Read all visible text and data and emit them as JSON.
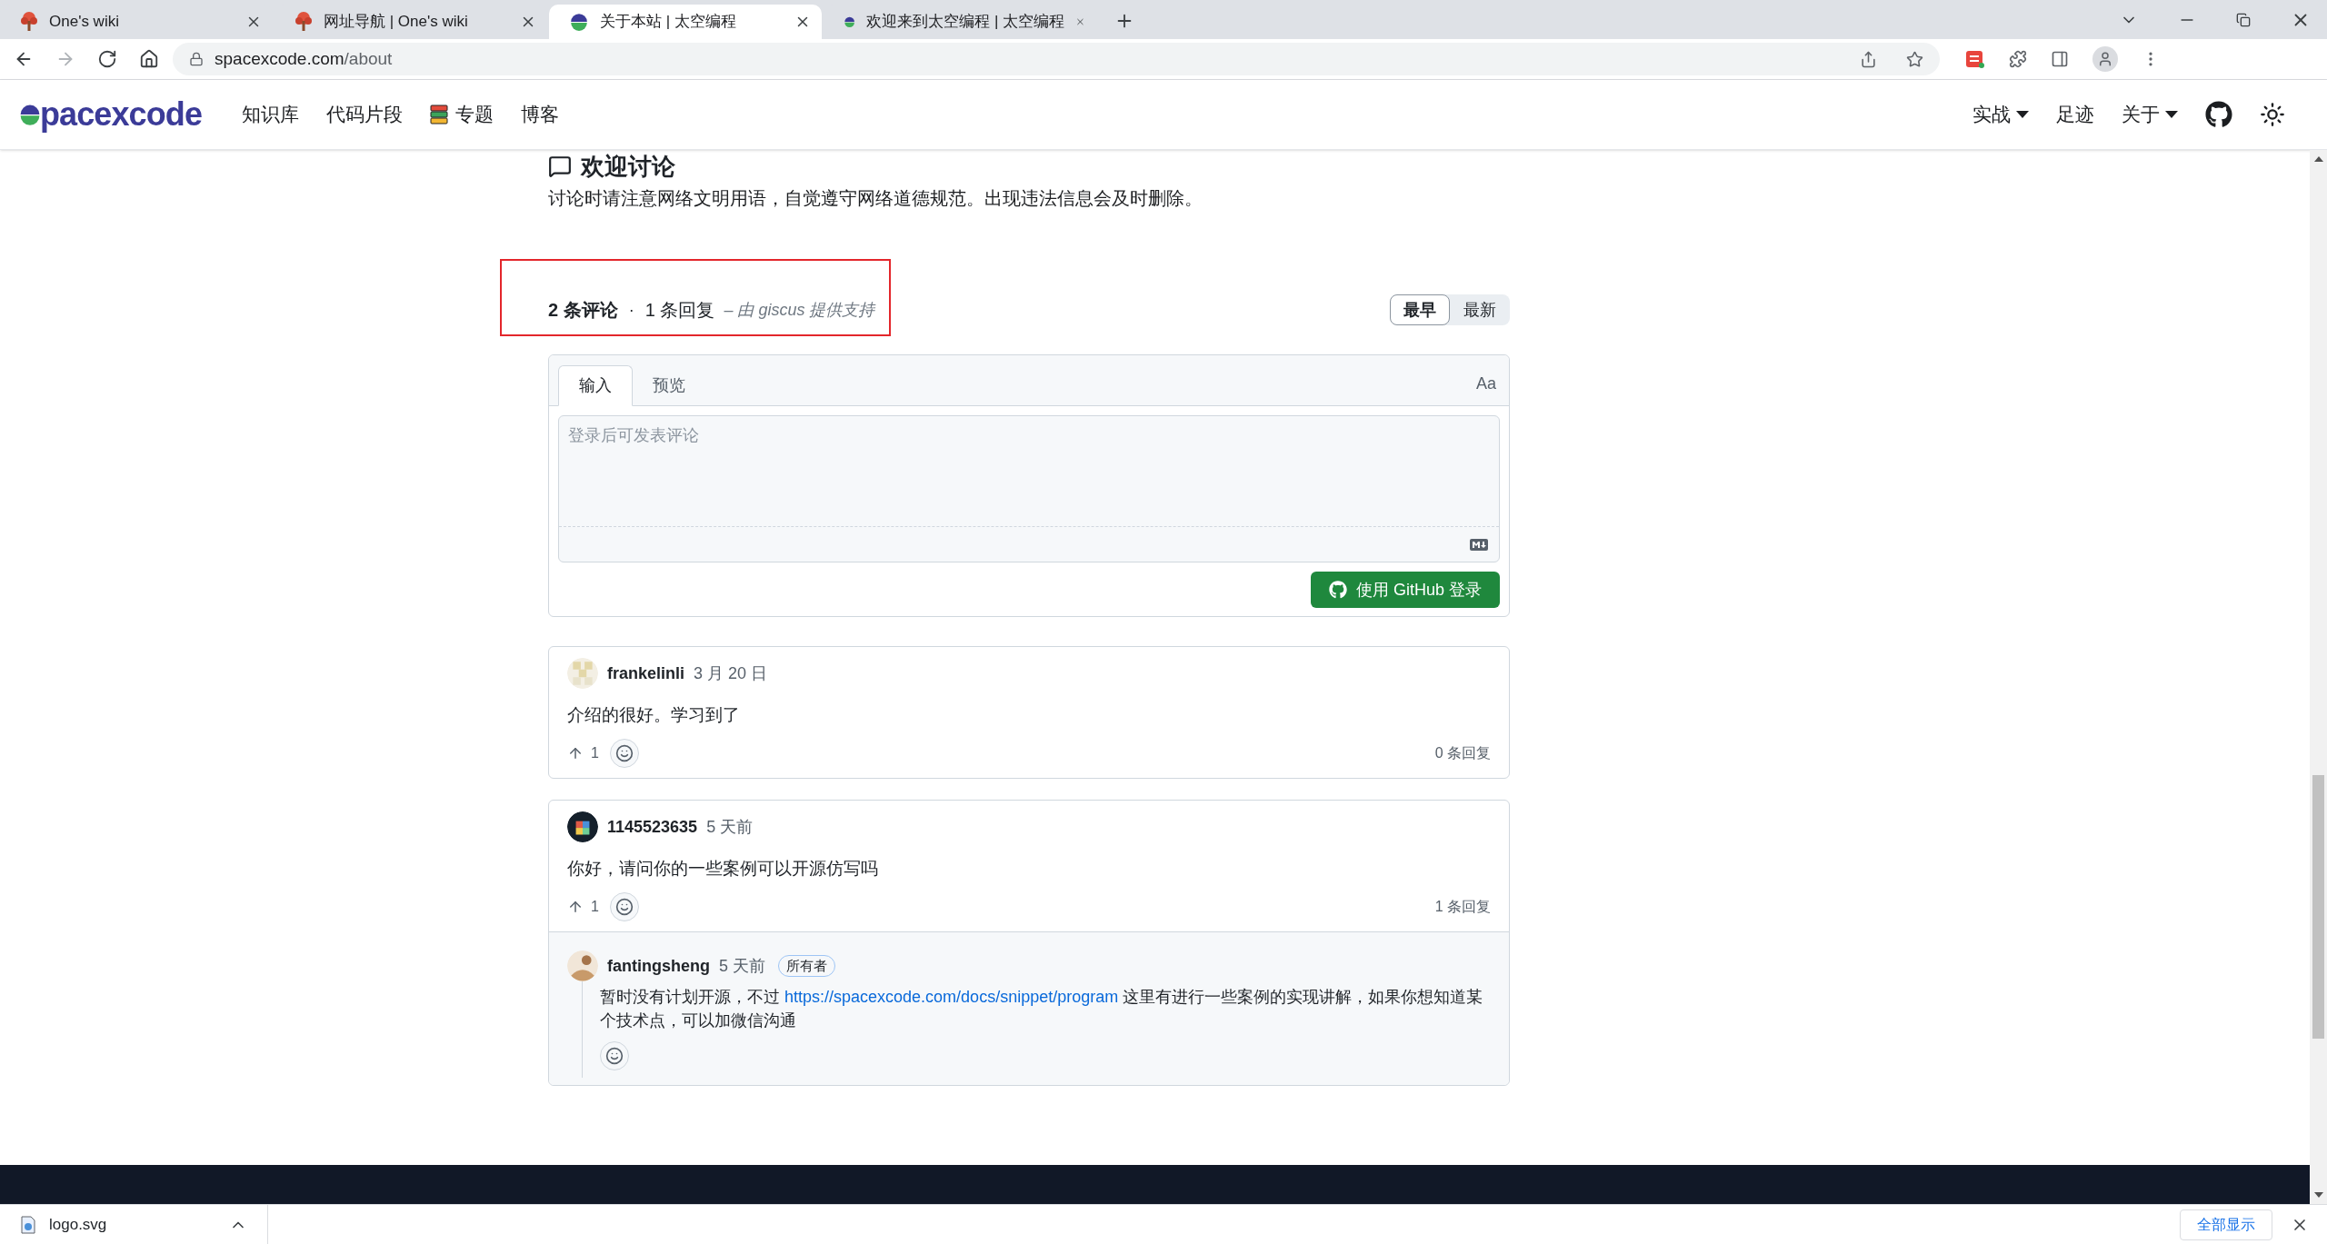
{
  "browser": {
    "tabs": [
      {
        "title": "One's wiki",
        "kind": "tree",
        "selected": false
      },
      {
        "title": "网址导航 | One's wiki",
        "kind": "tree",
        "selected": false
      },
      {
        "title": "关于本站 | 太空编程",
        "kind": "site",
        "selected": true
      },
      {
        "title": "欢迎来到太空编程 | 太空编程",
        "kind": "site",
        "selected": false
      }
    ],
    "nav_buttons": [
      {
        "kind": "back",
        "disabled": false
      },
      {
        "kind": "forward",
        "disabled": true
      },
      {
        "kind": "reload",
        "disabled": false
      },
      {
        "kind": "home",
        "disabled": false
      }
    ],
    "address": {
      "host": "spacexcode.com",
      "path": "/about"
    }
  },
  "site_nav": {
    "logo": "pacexcode",
    "items": [
      {
        "label": "知识库",
        "kind": "text"
      },
      {
        "label": "代码片段",
        "kind": "text"
      },
      {
        "label": "专题",
        "kind": "icon"
      },
      {
        "label": "博客",
        "kind": "text"
      }
    ],
    "right_items": [
      {
        "label": "实战",
        "dropdown": true
      },
      {
        "label": "足迹",
        "dropdown": false
      },
      {
        "label": "关于",
        "dropdown": true
      }
    ]
  },
  "discussion": {
    "title": "欢迎讨论",
    "note": "讨论时请注意网络文明用语，自觉遵守网络道德规范。出现违法信息会及时删除。"
  },
  "comments_header": {
    "count": "2 条评论",
    "separator": "·",
    "replies": "1 条回复",
    "credit": "– 由 giscus 提供支持",
    "sort": [
      {
        "label": "最早",
        "selected": true
      },
      {
        "label": "最新",
        "selected": false
      }
    ]
  },
  "editor": {
    "tabs": [
      {
        "label": "输入",
        "selected": true
      },
      {
        "label": "预览",
        "selected": false
      }
    ],
    "font_toggle": "Aa",
    "placeholder": "登录后可发表评论",
    "login_button": "使用 GitHub 登录"
  },
  "comments": [
    {
      "author": "frankelinli",
      "time": "3 月 20 日",
      "body": "介绍的很好。学习到了",
      "upvotes": "1",
      "replies_label": "0 条回复"
    },
    {
      "author": "1145523635",
      "time": "5 天前",
      "body": "你好，请问你的一些案例可以开源仿写吗",
      "upvotes": "1",
      "replies_label": "1 条回复",
      "replies": [
        {
          "author": "fantingsheng",
          "time": "5 天前",
          "badge": "所有者",
          "before": "暂时没有计划开源，不过",
          "link": "https://spacexcode.com/docs/snippet/program",
          "after": "这里有进行一些案例的实现讲解，如果你想知道某个技术点，可以加微信沟通"
        }
      ]
    }
  ],
  "download_bar": {
    "file": "logo.svg",
    "show_all": "全部显示"
  }
}
